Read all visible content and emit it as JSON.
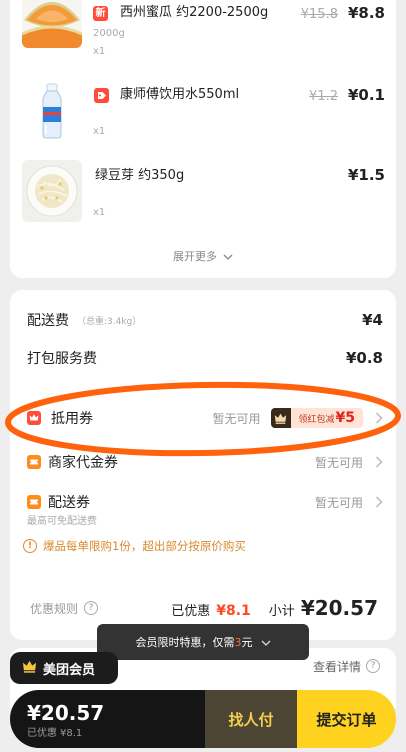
{
  "products": [
    {
      "image_icon": "cantaloupe-image",
      "badge": "新",
      "name": "西州蜜瓜 约2200-2500g",
      "spec": "2000g",
      "qty": "x1",
      "original_price": "¥15.8",
      "price": "¥8.8"
    },
    {
      "image_icon": "water-bottle-image",
      "badge_icon": "discount-badge-icon",
      "name": "康师傅饮用水550ml",
      "qty": "x1",
      "original_price": "¥1.2",
      "price": "¥0.1"
    },
    {
      "image_icon": "bean-sprouts-image",
      "name": "绿豆芽 约350g",
      "qty": "x1",
      "price": "¥1.5"
    }
  ],
  "expand_more": "展开更多",
  "fees": {
    "delivery_label": "配送费",
    "delivery_weight": "（总重:3.4kg）",
    "delivery_value": "¥4",
    "packing_label": "打包服务费",
    "packing_value": "¥0.8"
  },
  "coupons": [
    {
      "icon": "voucher-icon",
      "label": "抵用券",
      "status": "暂无可用",
      "promo_icon": "crown-icon",
      "promo_text": "领红包减",
      "promo_amount": "¥5"
    },
    {
      "icon": "coupon-icon",
      "label": "商家代金券",
      "status": "暂无可用"
    },
    {
      "icon": "coupon-icon",
      "label": "配送券",
      "status": "暂无可用",
      "note": "最高可免配送费"
    }
  ],
  "notice": "爆品每单限购1份，超出部分按原价购买",
  "summary": {
    "rules_label": "优惠规则",
    "discount_label": "已优惠",
    "discount_value": "¥8.1",
    "subtotal_label": "小计",
    "subtotal_value": "¥20.57"
  },
  "tooltip": {
    "text_before": "会员限时特惠，仅需",
    "highlight": "3",
    "text_after": "元"
  },
  "membership": {
    "tag": "美团会员",
    "details_link": "查看详情"
  },
  "footer": {
    "total": "¥20.57",
    "discount_label": "已优惠",
    "discount_value": "¥8.1",
    "pay_by_others": "找人付",
    "submit": "提交订单"
  },
  "icons": {
    "help": "?",
    "warning": "!",
    "chevron_right": "chevron-right-icon",
    "chevron_down": "chevron-down-icon"
  },
  "colors": {
    "accent_yellow": "#ffd21f",
    "price_red": "#ff4a26",
    "badge_red": "#ff4b3a",
    "coupon_orange": "#ff8c1a",
    "notice_orange": "#d98a2e",
    "member_gold": "#f6cf4f",
    "annotation_orange": "#ff5a00"
  }
}
